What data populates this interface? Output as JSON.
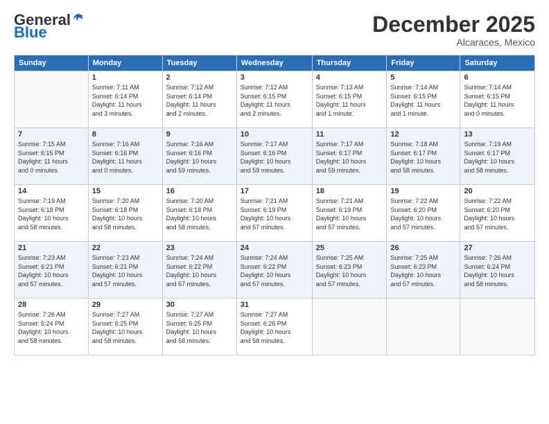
{
  "logo": {
    "general": "General",
    "blue": "Blue"
  },
  "title": {
    "month_year": "December 2025",
    "location": "Alcaraces, Mexico"
  },
  "weekdays": [
    "Sunday",
    "Monday",
    "Tuesday",
    "Wednesday",
    "Thursday",
    "Friday",
    "Saturday"
  ],
  "weeks": [
    [
      {
        "day": "",
        "info": ""
      },
      {
        "day": "1",
        "info": "Sunrise: 7:11 AM\nSunset: 6:14 PM\nDaylight: 11 hours\nand 3 minutes."
      },
      {
        "day": "2",
        "info": "Sunrise: 7:12 AM\nSunset: 6:14 PM\nDaylight: 11 hours\nand 2 minutes."
      },
      {
        "day": "3",
        "info": "Sunrise: 7:12 AM\nSunset: 6:15 PM\nDaylight: 11 hours\nand 2 minutes."
      },
      {
        "day": "4",
        "info": "Sunrise: 7:13 AM\nSunset: 6:15 PM\nDaylight: 11 hours\nand 1 minute."
      },
      {
        "day": "5",
        "info": "Sunrise: 7:14 AM\nSunset: 6:15 PM\nDaylight: 11 hours\nand 1 minute."
      },
      {
        "day": "6",
        "info": "Sunrise: 7:14 AM\nSunset: 6:15 PM\nDaylight: 11 hours\nand 0 minutes."
      }
    ],
    [
      {
        "day": "7",
        "info": "Sunrise: 7:15 AM\nSunset: 6:15 PM\nDaylight: 11 hours\nand 0 minutes."
      },
      {
        "day": "8",
        "info": "Sunrise: 7:16 AM\nSunset: 6:16 PM\nDaylight: 11 hours\nand 0 minutes."
      },
      {
        "day": "9",
        "info": "Sunrise: 7:16 AM\nSunset: 6:16 PM\nDaylight: 10 hours\nand 59 minutes."
      },
      {
        "day": "10",
        "info": "Sunrise: 7:17 AM\nSunset: 6:16 PM\nDaylight: 10 hours\nand 59 minutes."
      },
      {
        "day": "11",
        "info": "Sunrise: 7:17 AM\nSunset: 6:17 PM\nDaylight: 10 hours\nand 59 minutes."
      },
      {
        "day": "12",
        "info": "Sunrise: 7:18 AM\nSunset: 6:17 PM\nDaylight: 10 hours\nand 58 minutes."
      },
      {
        "day": "13",
        "info": "Sunrise: 7:19 AM\nSunset: 6:17 PM\nDaylight: 10 hours\nand 58 minutes."
      }
    ],
    [
      {
        "day": "14",
        "info": "Sunrise: 7:19 AM\nSunset: 6:18 PM\nDaylight: 10 hours\nand 58 minutes."
      },
      {
        "day": "15",
        "info": "Sunrise: 7:20 AM\nSunset: 6:18 PM\nDaylight: 10 hours\nand 58 minutes."
      },
      {
        "day": "16",
        "info": "Sunrise: 7:20 AM\nSunset: 6:18 PM\nDaylight: 10 hours\nand 58 minutes."
      },
      {
        "day": "17",
        "info": "Sunrise: 7:21 AM\nSunset: 6:19 PM\nDaylight: 10 hours\nand 57 minutes."
      },
      {
        "day": "18",
        "info": "Sunrise: 7:21 AM\nSunset: 6:19 PM\nDaylight: 10 hours\nand 57 minutes."
      },
      {
        "day": "19",
        "info": "Sunrise: 7:22 AM\nSunset: 6:20 PM\nDaylight: 10 hours\nand 57 minutes."
      },
      {
        "day": "20",
        "info": "Sunrise: 7:22 AM\nSunset: 6:20 PM\nDaylight: 10 hours\nand 57 minutes."
      }
    ],
    [
      {
        "day": "21",
        "info": "Sunrise: 7:23 AM\nSunset: 6:21 PM\nDaylight: 10 hours\nand 57 minutes."
      },
      {
        "day": "22",
        "info": "Sunrise: 7:23 AM\nSunset: 6:21 PM\nDaylight: 10 hours\nand 57 minutes."
      },
      {
        "day": "23",
        "info": "Sunrise: 7:24 AM\nSunset: 6:22 PM\nDaylight: 10 hours\nand 57 minutes."
      },
      {
        "day": "24",
        "info": "Sunrise: 7:24 AM\nSunset: 6:22 PM\nDaylight: 10 hours\nand 57 minutes."
      },
      {
        "day": "25",
        "info": "Sunrise: 7:25 AM\nSunset: 6:23 PM\nDaylight: 10 hours\nand 57 minutes."
      },
      {
        "day": "26",
        "info": "Sunrise: 7:25 AM\nSunset: 6:23 PM\nDaylight: 10 hours\nand 57 minutes."
      },
      {
        "day": "27",
        "info": "Sunrise: 7:26 AM\nSunset: 6:24 PM\nDaylight: 10 hours\nand 58 minutes."
      }
    ],
    [
      {
        "day": "28",
        "info": "Sunrise: 7:26 AM\nSunset: 6:24 PM\nDaylight: 10 hours\nand 58 minutes."
      },
      {
        "day": "29",
        "info": "Sunrise: 7:27 AM\nSunset: 6:25 PM\nDaylight: 10 hours\nand 58 minutes."
      },
      {
        "day": "30",
        "info": "Sunrise: 7:27 AM\nSunset: 6:25 PM\nDaylight: 10 hours\nand 58 minutes."
      },
      {
        "day": "31",
        "info": "Sunrise: 7:27 AM\nSunset: 6:26 PM\nDaylight: 10 hours\nand 58 minutes."
      },
      {
        "day": "",
        "info": ""
      },
      {
        "day": "",
        "info": ""
      },
      {
        "day": "",
        "info": ""
      }
    ]
  ]
}
